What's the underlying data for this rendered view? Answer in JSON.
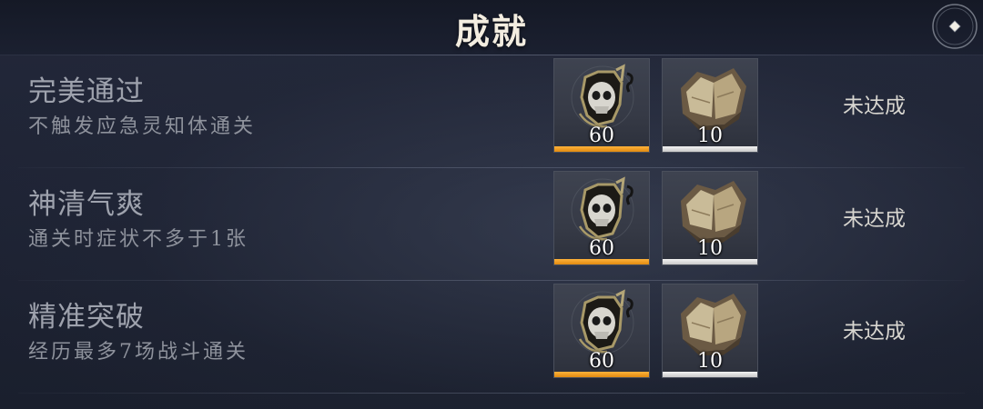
{
  "header": {
    "title": "成就",
    "close_icon": "compass-close-icon"
  },
  "colors": {
    "background": "#1b2030",
    "title_text": "#f3ede0",
    "rarity_orange": "#f39c1f",
    "rarity_white": "#e6e6e6"
  },
  "achievements": [
    {
      "name": "完美通过",
      "desc": "不触发应急灵知体通关",
      "rewards": [
        {
          "icon": "skull-relic-icon",
          "count": "60",
          "rarity": "orange"
        },
        {
          "icon": "torn-book-icon",
          "count": "10",
          "rarity": "white"
        }
      ],
      "status": "未达成"
    },
    {
      "name": "神清气爽",
      "desc": "通关时症状不多于1张",
      "rewards": [
        {
          "icon": "skull-relic-icon",
          "count": "60",
          "rarity": "orange"
        },
        {
          "icon": "torn-book-icon",
          "count": "10",
          "rarity": "white"
        }
      ],
      "status": "未达成"
    },
    {
      "name": "精准突破",
      "desc": "经历最多7场战斗通关",
      "rewards": [
        {
          "icon": "skull-relic-icon",
          "count": "60",
          "rarity": "orange"
        },
        {
          "icon": "torn-book-icon",
          "count": "10",
          "rarity": "white"
        }
      ],
      "status": "未达成"
    }
  ]
}
